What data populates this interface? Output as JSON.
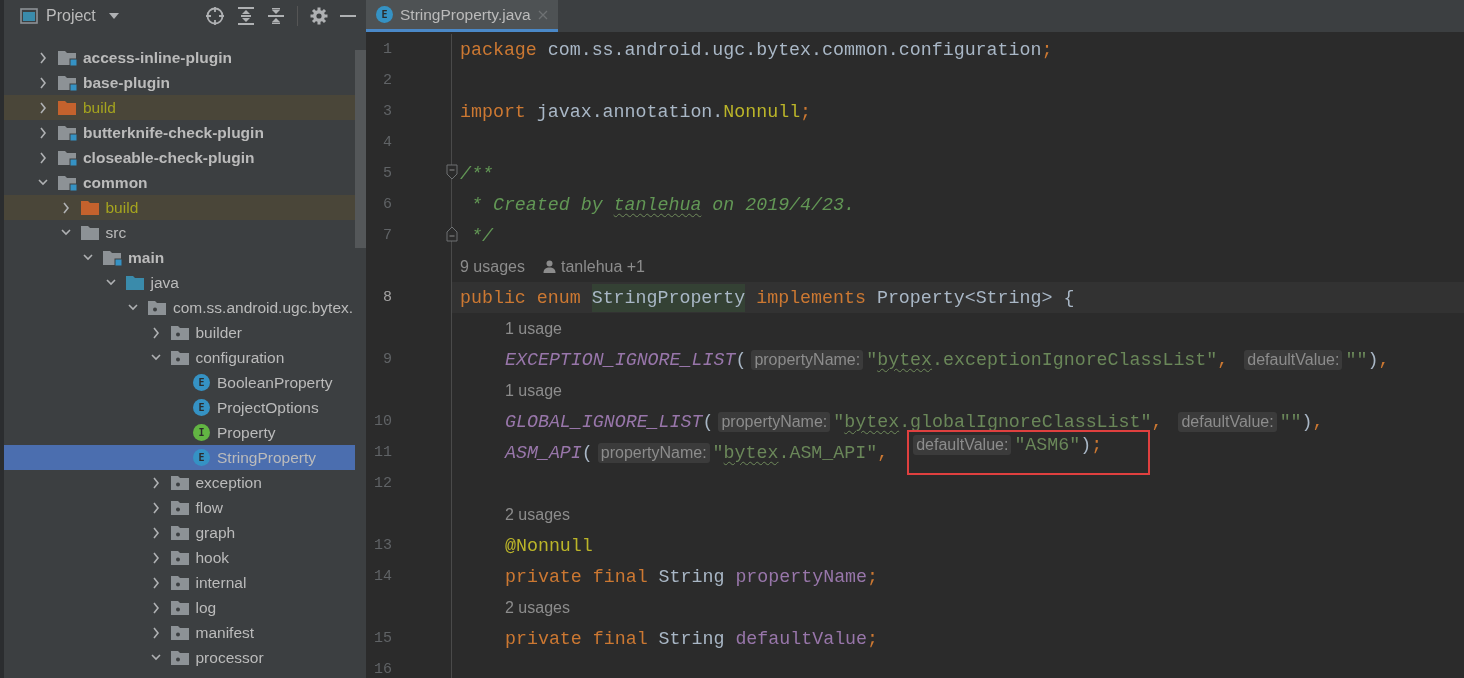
{
  "sidebar": {
    "title": "Project",
    "tree": [
      {
        "label": "access-inline-plugin",
        "kind": "module",
        "expanded": false,
        "selected": false
      },
      {
        "label": "base-plugin",
        "kind": "module",
        "expanded": false,
        "selected": false
      },
      {
        "label": "build",
        "kind": "excluded",
        "expanded": false,
        "selected": false
      },
      {
        "label": "butterknife-check-plugin",
        "kind": "module",
        "expanded": false,
        "selected": false
      },
      {
        "label": "closeable-check-plugin",
        "kind": "module",
        "expanded": false,
        "selected": false
      },
      {
        "label": "common",
        "kind": "module",
        "expanded": true,
        "selected": false,
        "children": [
          {
            "label": "build",
            "kind": "excluded",
            "expanded": false,
            "selected": false
          },
          {
            "label": "src",
            "kind": "folder",
            "expanded": true,
            "selected": false,
            "children": [
              {
                "label": "main",
                "kind": "module",
                "expanded": true,
                "selected": false,
                "children": [
                  {
                    "label": "java",
                    "kind": "source_root",
                    "expanded": true,
                    "selected": false,
                    "children": [
                      {
                        "label": "com.ss.android.ugc.bytex.",
                        "kind": "package",
                        "expanded": true,
                        "selected": false,
                        "children": [
                          {
                            "label": "builder",
                            "kind": "package",
                            "expanded": false,
                            "selected": false
                          },
                          {
                            "label": "configuration",
                            "kind": "package",
                            "expanded": true,
                            "selected": false,
                            "children": [
                              {
                                "label": "BooleanProperty",
                                "kind": "enum",
                                "badge": "E",
                                "selected": false
                              },
                              {
                                "label": "ProjectOptions",
                                "kind": "enum",
                                "badge": "E",
                                "selected": false
                              },
                              {
                                "label": "Property",
                                "kind": "interface",
                                "badge": "I",
                                "selected": false
                              },
                              {
                                "label": "StringProperty",
                                "kind": "enum",
                                "badge": "E",
                                "selected": true
                              }
                            ]
                          },
                          {
                            "label": "exception",
                            "kind": "package",
                            "expanded": false,
                            "selected": false
                          },
                          {
                            "label": "flow",
                            "kind": "package",
                            "expanded": false,
                            "selected": false
                          },
                          {
                            "label": "graph",
                            "kind": "package",
                            "expanded": false,
                            "selected": false
                          },
                          {
                            "label": "hook",
                            "kind": "package",
                            "expanded": false,
                            "selected": false
                          },
                          {
                            "label": "internal",
                            "kind": "package",
                            "expanded": false,
                            "selected": false
                          },
                          {
                            "label": "log",
                            "kind": "package",
                            "expanded": false,
                            "selected": false
                          },
                          {
                            "label": "manifest",
                            "kind": "package",
                            "expanded": false,
                            "selected": false
                          },
                          {
                            "label": "processor",
                            "kind": "package",
                            "expanded": true,
                            "selected": false
                          }
                        ]
                      }
                    ]
                  }
                ]
              }
            ]
          }
        ]
      }
    ]
  },
  "tabs": [
    {
      "label": "StringProperty.java",
      "badge": "E",
      "selected": true
    }
  ],
  "editor": {
    "lines": [
      {
        "kind": "code",
        "number": "1",
        "tokens": [
          {
            "kind": "keyword",
            "text": "package"
          },
          {
            "kind": "plain",
            "text": " com.ss.android.ugc.bytex.common.configuration"
          },
          {
            "kind": "keyword",
            "text": ";"
          }
        ]
      },
      {
        "kind": "code",
        "number": "2"
      },
      {
        "kind": "code",
        "number": "3",
        "tokens": [
          {
            "kind": "keyword",
            "text": "import"
          },
          {
            "kind": "plain",
            "text": " javax.annotation."
          },
          {
            "kind": "annotation",
            "text": "Nonnull"
          },
          {
            "kind": "keyword",
            "text": ";"
          }
        ]
      },
      {
        "kind": "code",
        "number": "4"
      },
      {
        "kind": "code",
        "number": "5",
        "fold_open": true,
        "tokens": [
          {
            "kind": "comment",
            "text": "/**"
          }
        ]
      },
      {
        "kind": "code",
        "number": "6",
        "tokens": [
          {
            "kind": "comment",
            "text": " * Created by "
          },
          {
            "kind": "comment",
            "text": "tanlehua",
            "typo": true
          },
          {
            "kind": "comment",
            "text": " on 2019/4/23."
          }
        ]
      },
      {
        "kind": "code",
        "number": "7",
        "fold_close": true,
        "tokens": [
          {
            "kind": "comment",
            "text": " */"
          }
        ]
      },
      {
        "kind": "lens",
        "usages": "9 usages",
        "author": "tanlehua +1"
      },
      {
        "kind": "code",
        "number": "8",
        "current": true,
        "tokens": [
          {
            "kind": "keyword",
            "text": "public enum "
          },
          {
            "kind": "declaration",
            "text": "StringProperty"
          },
          {
            "kind": "keyword",
            "text": " implements "
          },
          {
            "kind": "plain",
            "text": "Property<String> {"
          }
        ]
      },
      {
        "kind": "lens",
        "indent": true,
        "usages": "1 usage"
      },
      {
        "kind": "code",
        "number": "9",
        "indent": true,
        "tokens": [
          {
            "kind": "constant",
            "text": "EXCEPTION_IGNORE_LIST"
          },
          {
            "kind": "plain",
            "text": "("
          },
          {
            "kind": "hint",
            "text": "propertyName:"
          },
          {
            "kind": "string",
            "text": "\""
          },
          {
            "kind": "string",
            "text": "bytex",
            "typo": true
          },
          {
            "kind": "string",
            "text": ".exceptionIgnoreClassList\""
          },
          {
            "kind": "keyword",
            "text": ", "
          },
          {
            "kind": "hint",
            "text": "defaultValue:"
          },
          {
            "kind": "string",
            "text": "\"\""
          },
          {
            "kind": "plain",
            "text": ")"
          },
          {
            "kind": "keyword",
            "text": ","
          }
        ]
      },
      {
        "kind": "lens",
        "indent": true,
        "usages": "1 usage"
      },
      {
        "kind": "code",
        "number": "10",
        "indent": true,
        "tokens": [
          {
            "kind": "constant",
            "text": "GLOBAL_IGNORE_LIST"
          },
          {
            "kind": "plain",
            "text": "("
          },
          {
            "kind": "hint",
            "text": "propertyName:"
          },
          {
            "kind": "string",
            "text": "\""
          },
          {
            "kind": "string",
            "text": "bytex",
            "typo": true
          },
          {
            "kind": "string",
            "text": ".globalIgnoreClassList\""
          },
          {
            "kind": "keyword",
            "text": ", "
          },
          {
            "kind": "hint",
            "text": "defaultValue:"
          },
          {
            "kind": "string",
            "text": "\"\""
          },
          {
            "kind": "plain",
            "text": ")"
          },
          {
            "kind": "keyword",
            "text": ","
          }
        ]
      },
      {
        "kind": "code",
        "number": "11",
        "indent": true,
        "tokens": [
          {
            "kind": "constant",
            "text": "ASM_API"
          },
          {
            "kind": "plain",
            "text": "("
          },
          {
            "kind": "hint",
            "text": "propertyName:"
          },
          {
            "kind": "string",
            "text": "\""
          },
          {
            "kind": "string",
            "text": "bytex",
            "typo": true
          },
          {
            "kind": "string",
            "text": ".ASM_API\""
          },
          {
            "kind": "keyword",
            "text": ", "
          },
          {
            "kind": "hint",
            "text": "defaultValue:",
            "boxed": true
          },
          {
            "kind": "string",
            "text": "\"ASM6\"",
            "boxed": true
          },
          {
            "kind": "plain",
            "text": ")",
            "boxed": true
          },
          {
            "kind": "keyword",
            "text": ";",
            "boxed": true
          }
        ]
      },
      {
        "kind": "code",
        "number": "12"
      },
      {
        "kind": "lens",
        "indent": true,
        "usages": "2 usages"
      },
      {
        "kind": "code",
        "number": "13",
        "indent": true,
        "tokens": [
          {
            "kind": "annotation",
            "text": "@Nonnull"
          }
        ]
      },
      {
        "kind": "code",
        "number": "14",
        "indent": true,
        "tokens": [
          {
            "kind": "keyword",
            "text": "private final "
          },
          {
            "kind": "plain",
            "text": "String "
          },
          {
            "kind": "field",
            "text": "propertyName"
          },
          {
            "kind": "keyword",
            "text": ";"
          }
        ]
      },
      {
        "kind": "lens",
        "indent": true,
        "usages": "2 usages"
      },
      {
        "kind": "code",
        "number": "15",
        "indent": true,
        "tokens": [
          {
            "kind": "keyword",
            "text": "private final "
          },
          {
            "kind": "plain",
            "text": "String "
          },
          {
            "kind": "field",
            "text": "defaultValue"
          },
          {
            "kind": "keyword",
            "text": ";"
          }
        ]
      },
      {
        "kind": "code",
        "number": "16"
      }
    ]
  }
}
